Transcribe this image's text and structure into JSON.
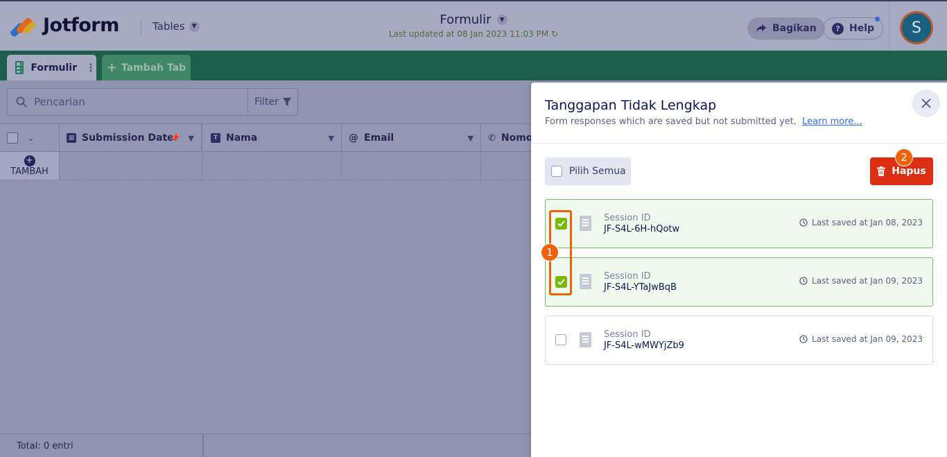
{
  "header": {
    "logo_text": "Jotform",
    "tables_label": "Tables",
    "form_title": "Formulir",
    "last_updated": "Last updated at 08 Jan 2023 11:03 PM",
    "share_label": "Bagikan",
    "help_label": "Help",
    "avatar_letter": "S"
  },
  "tabs": {
    "active_label": "Formulir",
    "add_label": "Tambah Tab"
  },
  "toolbar": {
    "search_placeholder": "Pencarian",
    "filter_label": "Filter"
  },
  "grid": {
    "columns": [
      "Submission Date",
      "Nama",
      "Email",
      "Nomo"
    ],
    "add_row_label": "TAMBAH",
    "footer_total": "Total: 0 entri"
  },
  "panel": {
    "title": "Tanggapan Tidak Lengkap",
    "subtitle": "Form responses which are saved but not submitted yet.",
    "learn_more": "Learn more...",
    "select_all_label": "Pilih Semua",
    "delete_label": "Hapus",
    "items": [
      {
        "label": "Session ID",
        "id": "JF-S4L-6H-hQotw",
        "saved": "Last saved at Jan 08, 2023",
        "checked": true
      },
      {
        "label": "Session ID",
        "id": "JF-S4L-YTaJwBqB",
        "saved": "Last saved at Jan 09, 2023",
        "checked": true
      },
      {
        "label": "Session ID",
        "id": "JF-S4L-wMWYjZb9",
        "saved": "Last saved at Jan 09, 2023",
        "checked": false
      }
    ]
  },
  "annotations": {
    "badge_1": "1",
    "badge_2": "2"
  },
  "colors": {
    "accent_green": "#1d5e4a",
    "delete_red": "#dc2e12",
    "annotation_orange": "#f0610a",
    "checked_green": "#78bb07"
  }
}
